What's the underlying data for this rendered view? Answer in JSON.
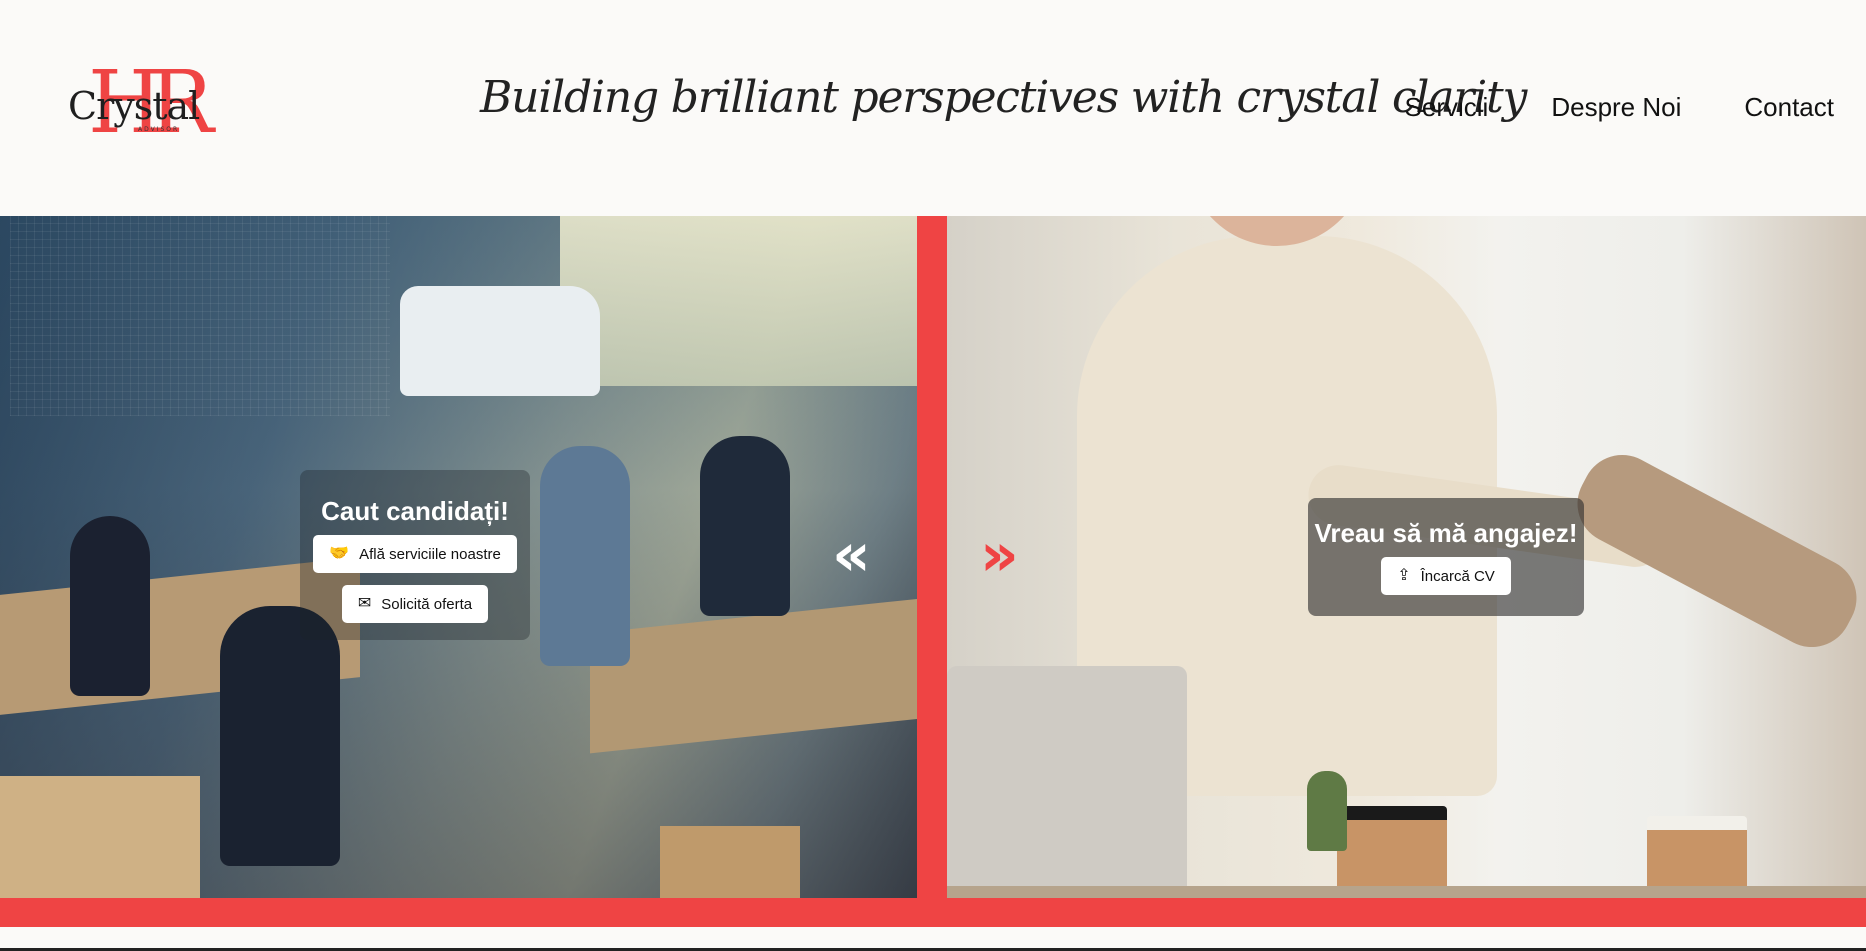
{
  "logo": {
    "initials": "HR",
    "wordmark": "Crystal",
    "subtitle": "ADVISOR"
  },
  "tagline": "Building brilliant perspectives with crystal clarity",
  "nav": {
    "items": [
      "Servicii",
      "Despre Noi",
      "Contact"
    ]
  },
  "hero": {
    "left": {
      "heading": "Caut candidați!",
      "buttons": [
        {
          "label": "Află serviciile noastre",
          "icon": "handshake-icon"
        },
        {
          "label": "Solicită oferta",
          "icon": "mail-icon"
        }
      ],
      "arrow": "«"
    },
    "right": {
      "heading": "Vreau să mă angajez!",
      "button": {
        "label": "Încarcă CV",
        "icon": "file-upload-icon"
      },
      "arrow": "»"
    }
  },
  "colors": {
    "accent": "#ef4444",
    "background": "#fbfaf8",
    "text": "#111111"
  }
}
